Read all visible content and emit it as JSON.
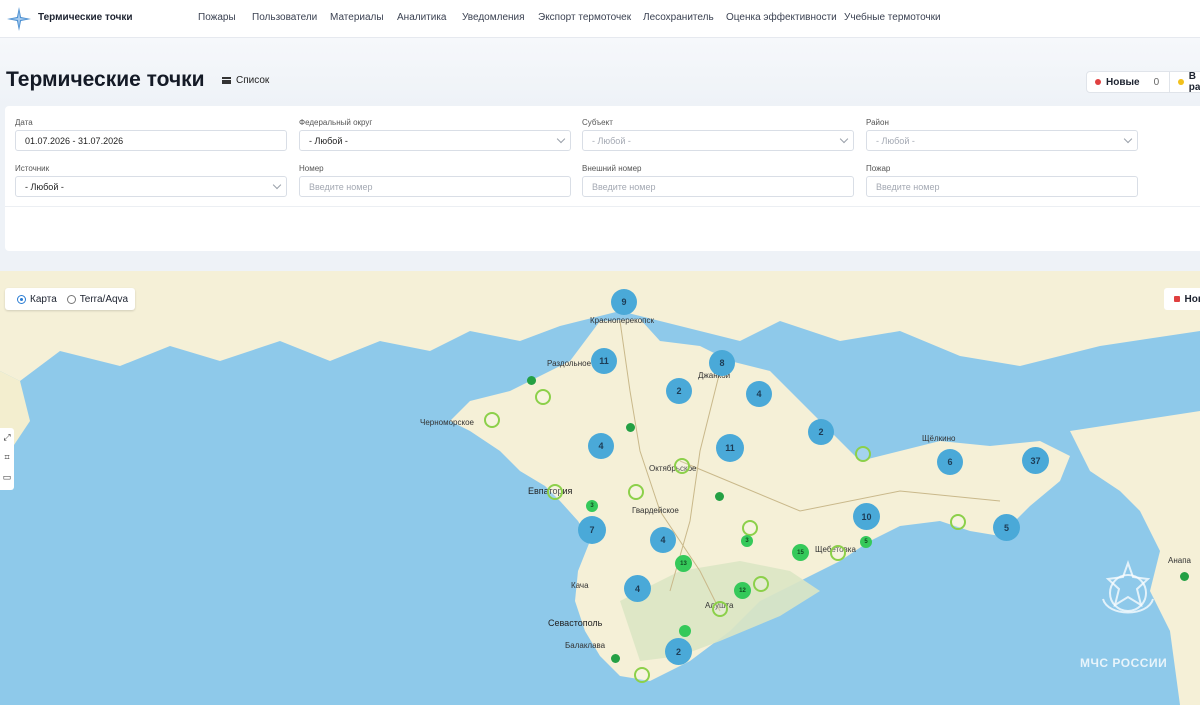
{
  "nav": {
    "brand": "Термические точки",
    "items": [
      "Пожары",
      "Пользователи",
      "Материалы",
      "Аналитика",
      "Уведомления",
      "Экспорт термоточек",
      "Лесохранитель",
      "Оценка эффективности",
      "Учебные термоточки"
    ]
  },
  "page": {
    "title": "Термические точки",
    "list_label": "Список"
  },
  "status_legend": {
    "new_label": "Новые",
    "new_count": "0",
    "in_work_label": "В раб"
  },
  "filters": {
    "date_label": "Дата",
    "date_value": "01.07.2026 - 31.07.2026",
    "district_label": "Федеральный округ",
    "district_value": "- Любой -",
    "subject_label": "Субъект",
    "subject_value": "- Любой -",
    "region_label": "Район",
    "region_value": "- Любой -",
    "source_label": "Источник",
    "source_value": "- Любой -",
    "number_label": "Номер",
    "number_placeholder": "Введите номер",
    "ext_number_label": "Внешний номер",
    "ext_number_placeholder": "Введите номер",
    "fire_label": "Пожар",
    "fire_placeholder": "Введите номер"
  },
  "map": {
    "layer_map": "Карта",
    "layer_terra": "Terra/Aqva",
    "legend_new": "Нов",
    "watermark": "МЧС РОССИИ",
    "places": [
      "Красноперекопск",
      "Раздольное",
      "Джанкой",
      "Черноморское",
      "Октябрьское",
      "Евпатория",
      "Гвардейское",
      "Щёлкино",
      "Щебетовка",
      "Кача",
      "Севастополь",
      "Балаклава",
      "Алушта",
      "Анапа"
    ],
    "clusters": [
      "9",
      "11",
      "8",
      "2",
      "4",
      "4",
      "11",
      "2",
      "6",
      "37",
      "10",
      "5",
      "7",
      "4",
      "4",
      "2"
    ],
    "green_counts": [
      "3",
      "13",
      "15",
      "12",
      "3",
      "5"
    ],
    "colors": {
      "cluster": "#4aa9d8",
      "ring": "#8cd04a",
      "green": "#35c95a",
      "sea": "#8ec9ea",
      "land": "#f5f0d7"
    }
  }
}
